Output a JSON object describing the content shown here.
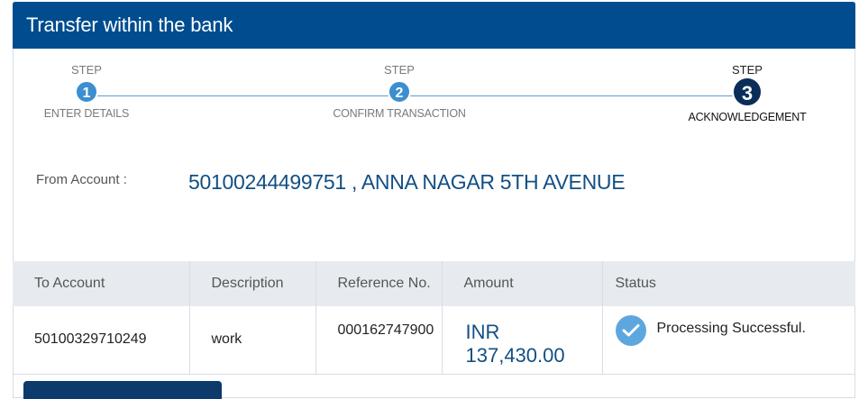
{
  "header": {
    "title": "Transfer within the bank"
  },
  "stepper": {
    "steps": [
      {
        "title": "STEP",
        "number": "1",
        "label": "ENTER DETAILS",
        "active": false
      },
      {
        "title": "STEP",
        "number": "2",
        "label": "CONFIRM TRANSACTION",
        "active": false
      },
      {
        "title": "STEP",
        "number": "3",
        "label": "ACKNOWLEDGEMENT",
        "active": true
      }
    ]
  },
  "from_account": {
    "label": "From Account :",
    "value": "50100244499751 , ANNA NAGAR 5TH AVENUE"
  },
  "table": {
    "headers": [
      "To Account",
      "Description",
      "Reference No.",
      "Amount",
      "Status"
    ],
    "row": {
      "to_account": "50100329710249",
      "description": "work",
      "reference": "000162747900",
      "amount_currency": "INR",
      "amount_value": "137,430.00",
      "status": "Processing Successful.",
      "status_icon": "check-circle-icon"
    }
  },
  "colors": {
    "header_bg": "#004c8f",
    "accent": "#124f84",
    "step_active": "#0b2e59",
    "step_inactive": "#3b8fd0"
  }
}
